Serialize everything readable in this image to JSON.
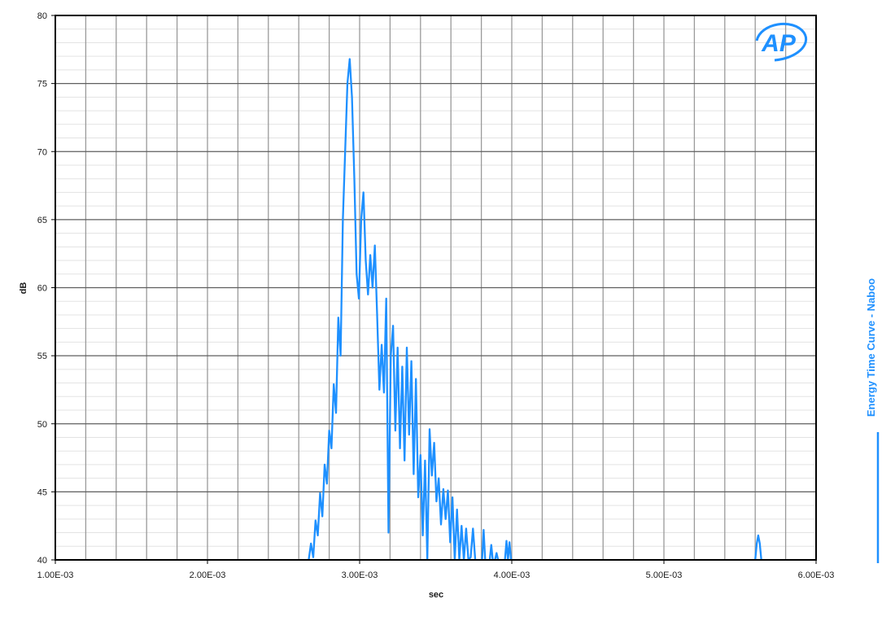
{
  "chart_data": {
    "type": "line",
    "title": "",
    "xlabel": "sec",
    "ylabel": "dB",
    "xlim": [
      0.001,
      0.006
    ],
    "ylim": [
      40,
      80
    ],
    "x_ticks": [
      0.001,
      0.002,
      0.003,
      0.004,
      0.005,
      0.006
    ],
    "x_tick_labels": [
      "1.00E-03",
      "2.00E-03",
      "3.00E-03",
      "4.00E-03",
      "5.00E-03",
      "6.00E-03"
    ],
    "y_ticks": [
      40,
      45,
      50,
      55,
      60,
      65,
      70,
      75,
      80
    ],
    "y_tick_labels": [
      "40",
      "45",
      "50",
      "55",
      "60",
      "65",
      "70",
      "75",
      "80"
    ],
    "grid": true,
    "legend_position": "right, vertical",
    "logo_text": "AP",
    "series": [
      {
        "name": "Energy Time Curve - Naboo",
        "color": "#1e90ff",
        "points": [
          [
            0.002665,
            40.0
          ],
          [
            0.00268,
            41.2
          ],
          [
            0.002695,
            40.2
          ],
          [
            0.00271,
            42.9
          ],
          [
            0.002725,
            41.8
          ],
          [
            0.00274,
            44.9
          ],
          [
            0.002755,
            43.2
          ],
          [
            0.00277,
            47.0
          ],
          [
            0.002785,
            45.6
          ],
          [
            0.0028,
            49.5
          ],
          [
            0.002815,
            48.2
          ],
          [
            0.00283,
            52.9
          ],
          [
            0.002845,
            50.8
          ],
          [
            0.00286,
            57.8
          ],
          [
            0.002875,
            55.0
          ],
          [
            0.00289,
            65.0
          ],
          [
            0.002905,
            70.0
          ],
          [
            0.00292,
            75.0
          ],
          [
            0.002935,
            76.8
          ],
          [
            0.00295,
            74.0
          ],
          [
            0.002965,
            68.0
          ],
          [
            0.00298,
            61.0
          ],
          [
            0.002995,
            59.2
          ],
          [
            0.00301,
            65.0
          ],
          [
            0.003025,
            67.0
          ],
          [
            0.00304,
            62.0
          ],
          [
            0.003055,
            59.5
          ],
          [
            0.00307,
            62.4
          ],
          [
            0.003085,
            60.0
          ],
          [
            0.0031,
            63.1
          ],
          [
            0.003115,
            58.0
          ],
          [
            0.00313,
            52.5
          ],
          [
            0.003145,
            55.8
          ],
          [
            0.00316,
            52.3
          ],
          [
            0.003175,
            59.2
          ],
          [
            0.00319,
            42.0
          ],
          [
            0.003205,
            55.0
          ],
          [
            0.00322,
            57.2
          ],
          [
            0.003235,
            49.5
          ],
          [
            0.00325,
            55.6
          ],
          [
            0.003265,
            48.2
          ],
          [
            0.00328,
            54.2
          ],
          [
            0.003295,
            47.3
          ],
          [
            0.00331,
            55.6
          ],
          [
            0.003325,
            49.2
          ],
          [
            0.00334,
            54.6
          ],
          [
            0.003355,
            46.3
          ],
          [
            0.00337,
            53.3
          ],
          [
            0.003385,
            44.6
          ],
          [
            0.0034,
            47.7
          ],
          [
            0.003415,
            41.8
          ],
          [
            0.00343,
            47.3
          ],
          [
            0.003445,
            40.0
          ],
          [
            0.00346,
            49.6
          ],
          [
            0.003475,
            46.2
          ],
          [
            0.00349,
            48.6
          ],
          [
            0.003505,
            44.3
          ],
          [
            0.00352,
            46.0
          ],
          [
            0.003535,
            42.6
          ],
          [
            0.00355,
            45.2
          ],
          [
            0.003565,
            43.0
          ],
          [
            0.00358,
            45.1
          ],
          [
            0.003595,
            41.3
          ],
          [
            0.00361,
            44.6
          ],
          [
            0.003625,
            40.0
          ],
          [
            0.00364,
            43.7
          ],
          [
            0.003655,
            40.0
          ],
          [
            0.00367,
            42.5
          ],
          [
            0.003685,
            40.0
          ],
          [
            0.0037,
            42.3
          ],
          [
            0.003715,
            40.0
          ],
          [
            0.00373,
            40.2
          ],
          [
            0.003745,
            42.3
          ],
          [
            0.00376,
            40.0
          ],
          null,
          [
            0.003805,
            40.0
          ],
          [
            0.003815,
            42.2
          ],
          [
            0.003825,
            40.0
          ],
          null,
          [
            0.003855,
            40.0
          ],
          [
            0.003865,
            41.1
          ],
          [
            0.003875,
            40.0
          ],
          null,
          [
            0.00389,
            40.0
          ],
          [
            0.0039,
            40.5
          ],
          [
            0.00391,
            40.0
          ],
          null,
          [
            0.003955,
            40.0
          ],
          [
            0.003965,
            41.4
          ],
          [
            0.003975,
            40.0
          ],
          [
            0.003985,
            41.3
          ],
          [
            0.003995,
            40.0
          ],
          null,
          [
            0.0056,
            40.0
          ],
          [
            0.00561,
            41.2
          ],
          [
            0.00562,
            41.8
          ],
          [
            0.00563,
            41.2
          ],
          [
            0.00564,
            40.0
          ]
        ]
      }
    ]
  }
}
